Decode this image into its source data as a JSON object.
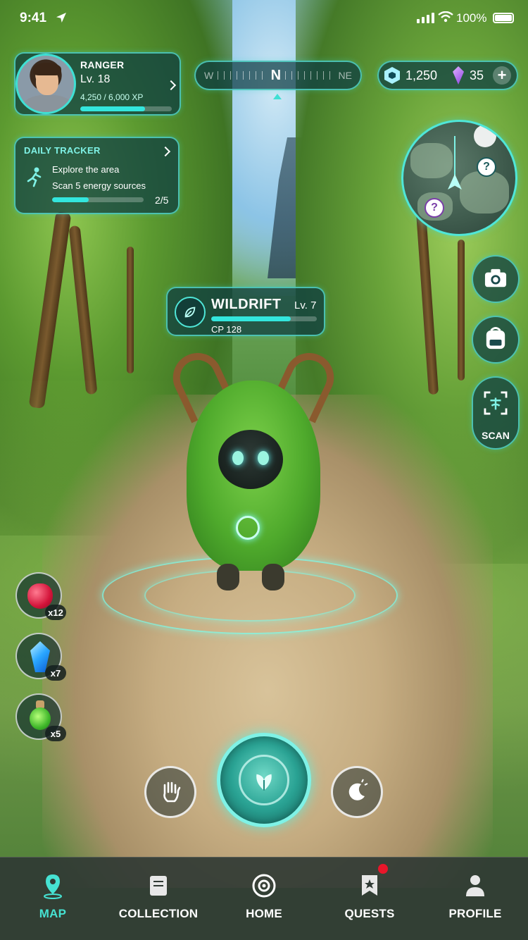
{
  "status_bar": {
    "time": "9:41",
    "battery": "100%"
  },
  "player": {
    "title": "RANGER",
    "level": "Lv. 18",
    "xp_text": "4,250 / 6,000 XP",
    "xp_progress": 0.708
  },
  "compass": {
    "west": "W",
    "north": "N",
    "northeast": "NE"
  },
  "currency": {
    "coins": "1,250",
    "gems": "35",
    "add_label": "+"
  },
  "daily_tracker": {
    "title": "DAILY TRACKER",
    "line1": "Explore the area",
    "line2": "Scan 5 energy sources",
    "count": "2/5",
    "progress": 0.4
  },
  "minimap": {
    "marker1": "?",
    "marker2": "?"
  },
  "side_buttons": {
    "scan_label": "SCAN"
  },
  "creature": {
    "name": "WILDRIFT",
    "level": "Lv. 7",
    "cp": "CP 128",
    "hp_progress": 0.75
  },
  "items": [
    {
      "name": "berry",
      "count": "x12"
    },
    {
      "name": "crystal",
      "count": "x7"
    },
    {
      "name": "potion",
      "count": "x5"
    }
  ],
  "nav": [
    {
      "label": "MAP",
      "icon": "map-pin-icon",
      "active": true
    },
    {
      "label": "COLLECTION",
      "icon": "book-icon",
      "active": false
    },
    {
      "label": "HOME",
      "icon": "target-icon",
      "active": false
    },
    {
      "label": "QUESTS",
      "icon": "quest-flag-icon",
      "active": false,
      "badge": true
    },
    {
      "label": "PROFILE",
      "icon": "person-icon",
      "active": false
    }
  ],
  "colors": {
    "accent": "#33e6dd",
    "panel": "#0c3c42",
    "nav_active": "#46e2d2",
    "badge": "#e8162a"
  }
}
